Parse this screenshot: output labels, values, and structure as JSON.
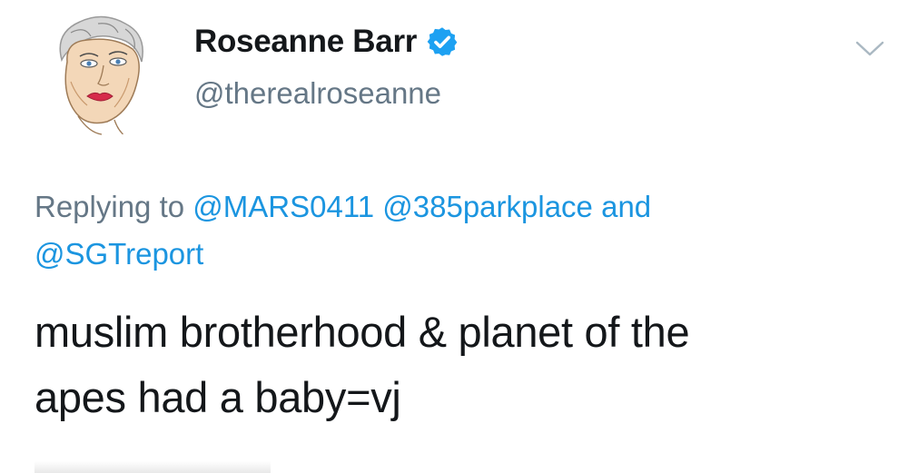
{
  "tweet": {
    "author": {
      "display_name": "Roseanne Barr",
      "handle": "@therealroseanne",
      "verified": true,
      "avatar_icon": "hand-drawn-portrait-avatar"
    },
    "reply": {
      "prefix": "Replying to",
      "mention_1": "@MARS0411",
      "mention_2": "@385parkplace",
      "conjunction": "and",
      "mention_3": "@SGTreport"
    },
    "text_line_1": "muslim brotherhood & planet of the",
    "text_line_2": "apes had a baby=vj",
    "menu_icon": "chevron-down-icon"
  },
  "colors": {
    "text_primary": "#14171a",
    "text_secondary": "#657786",
    "link": "#1b95e0",
    "verified_badge": "#1da1f2"
  }
}
